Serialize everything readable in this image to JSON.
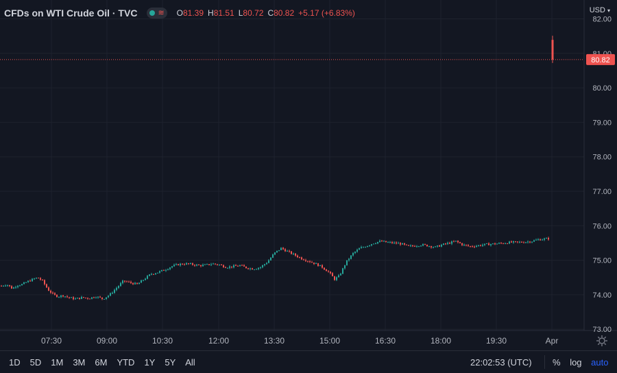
{
  "header": {
    "title": "CFDs on WTI Crude Oil · TVC",
    "ohlc": [
      {
        "k": "O",
        "v": "81.39"
      },
      {
        "k": "H",
        "v": "81.51"
      },
      {
        "k": "L",
        "v": "80.72"
      },
      {
        "k": "C",
        "v": "80.82"
      }
    ],
    "change": "+5.17 (+6.83%)"
  },
  "currency": "USD",
  "colors": {
    "background": "#131722",
    "up": "#26a69a",
    "down": "#ef5350",
    "grid": "#1e222d",
    "text": "#d1d4dc"
  },
  "bottom": {
    "ranges": [
      "1D",
      "5D",
      "1M",
      "3M",
      "6M",
      "YTD",
      "1Y",
      "5Y",
      "All"
    ],
    "clock": "22:02:53 (UTC)",
    "percent": "%",
    "log": "log",
    "auto": "auto"
  },
  "chart_data": {
    "type": "candlestick",
    "ylim": [
      73,
      82
    ],
    "y_ticks": [
      "73.00",
      "74.00",
      "75.00",
      "76.00",
      "77.00",
      "78.00",
      "79.00",
      "80.00",
      "81.00",
      "82.00"
    ],
    "x_ticks": [
      "07:30",
      "09:00",
      "10:30",
      "12:00",
      "13:30",
      "15:00",
      "16:30",
      "18:00",
      "19:30",
      "Apr"
    ],
    "last_price": "80.82",
    "grid": true,
    "close_path": [
      [
        0,
        74.25
      ],
      [
        10,
        74.3
      ],
      [
        18,
        74.18
      ],
      [
        25,
        74.28
      ],
      [
        32,
        74.3
      ],
      [
        40,
        74.38
      ],
      [
        48,
        74.45
      ],
      [
        55,
        74.5
      ],
      [
        62,
        74.4
      ],
      [
        70,
        74.15
      ],
      [
        78,
        74.0
      ],
      [
        85,
        73.95
      ],
      [
        92,
        73.98
      ],
      [
        100,
        73.92
      ],
      [
        110,
        73.88
      ],
      [
        120,
        73.92
      ],
      [
        130,
        73.9
      ],
      [
        140,
        73.95
      ],
      [
        150,
        73.88
      ],
      [
        160,
        74.0
      ],
      [
        170,
        74.2
      ],
      [
        180,
        74.4
      ],
      [
        190,
        74.35
      ],
      [
        200,
        74.3
      ],
      [
        210,
        74.45
      ],
      [
        220,
        74.6
      ],
      [
        230,
        74.65
      ],
      [
        240,
        74.72
      ],
      [
        250,
        74.82
      ],
      [
        260,
        74.88
      ],
      [
        270,
        74.9
      ],
      [
        280,
        74.88
      ],
      [
        290,
        74.85
      ],
      [
        300,
        74.86
      ],
      [
        310,
        74.9
      ],
      [
        320,
        74.87
      ],
      [
        330,
        74.8
      ],
      [
        340,
        74.82
      ],
      [
        350,
        74.85
      ],
      [
        360,
        74.78
      ],
      [
        370,
        74.75
      ],
      [
        380,
        74.8
      ],
      [
        390,
        74.95
      ],
      [
        400,
        75.2
      ],
      [
        410,
        75.35
      ],
      [
        420,
        75.25
      ],
      [
        430,
        75.15
      ],
      [
        440,
        75.05
      ],
      [
        450,
        74.98
      ],
      [
        460,
        74.9
      ],
      [
        470,
        74.8
      ],
      [
        480,
        74.65
      ],
      [
        488,
        74.45
      ],
      [
        495,
        74.55
      ],
      [
        505,
        74.95
      ],
      [
        515,
        75.2
      ],
      [
        525,
        75.35
      ],
      [
        535,
        75.42
      ],
      [
        545,
        75.5
      ],
      [
        555,
        75.55
      ],
      [
        565,
        75.52
      ],
      [
        575,
        75.5
      ],
      [
        585,
        75.48
      ],
      [
        595,
        75.4
      ],
      [
        605,
        75.42
      ],
      [
        615,
        75.45
      ],
      [
        625,
        75.42
      ],
      [
        635,
        75.38
      ],
      [
        645,
        75.45
      ],
      [
        655,
        75.5
      ],
      [
        665,
        75.55
      ],
      [
        675,
        75.45
      ],
      [
        685,
        75.4
      ],
      [
        695,
        75.42
      ],
      [
        705,
        75.45
      ],
      [
        715,
        75.47
      ],
      [
        725,
        75.48
      ],
      [
        735,
        75.5
      ],
      [
        745,
        75.52
      ],
      [
        755,
        75.52
      ],
      [
        765,
        75.53
      ],
      [
        775,
        75.55
      ],
      [
        785,
        75.6
      ],
      [
        795,
        75.62
      ],
      [
        801,
        75.63
      ]
    ],
    "last_candle": {
      "open": 81.39,
      "high": 81.51,
      "low": 80.72,
      "close": 80.82
    }
  }
}
